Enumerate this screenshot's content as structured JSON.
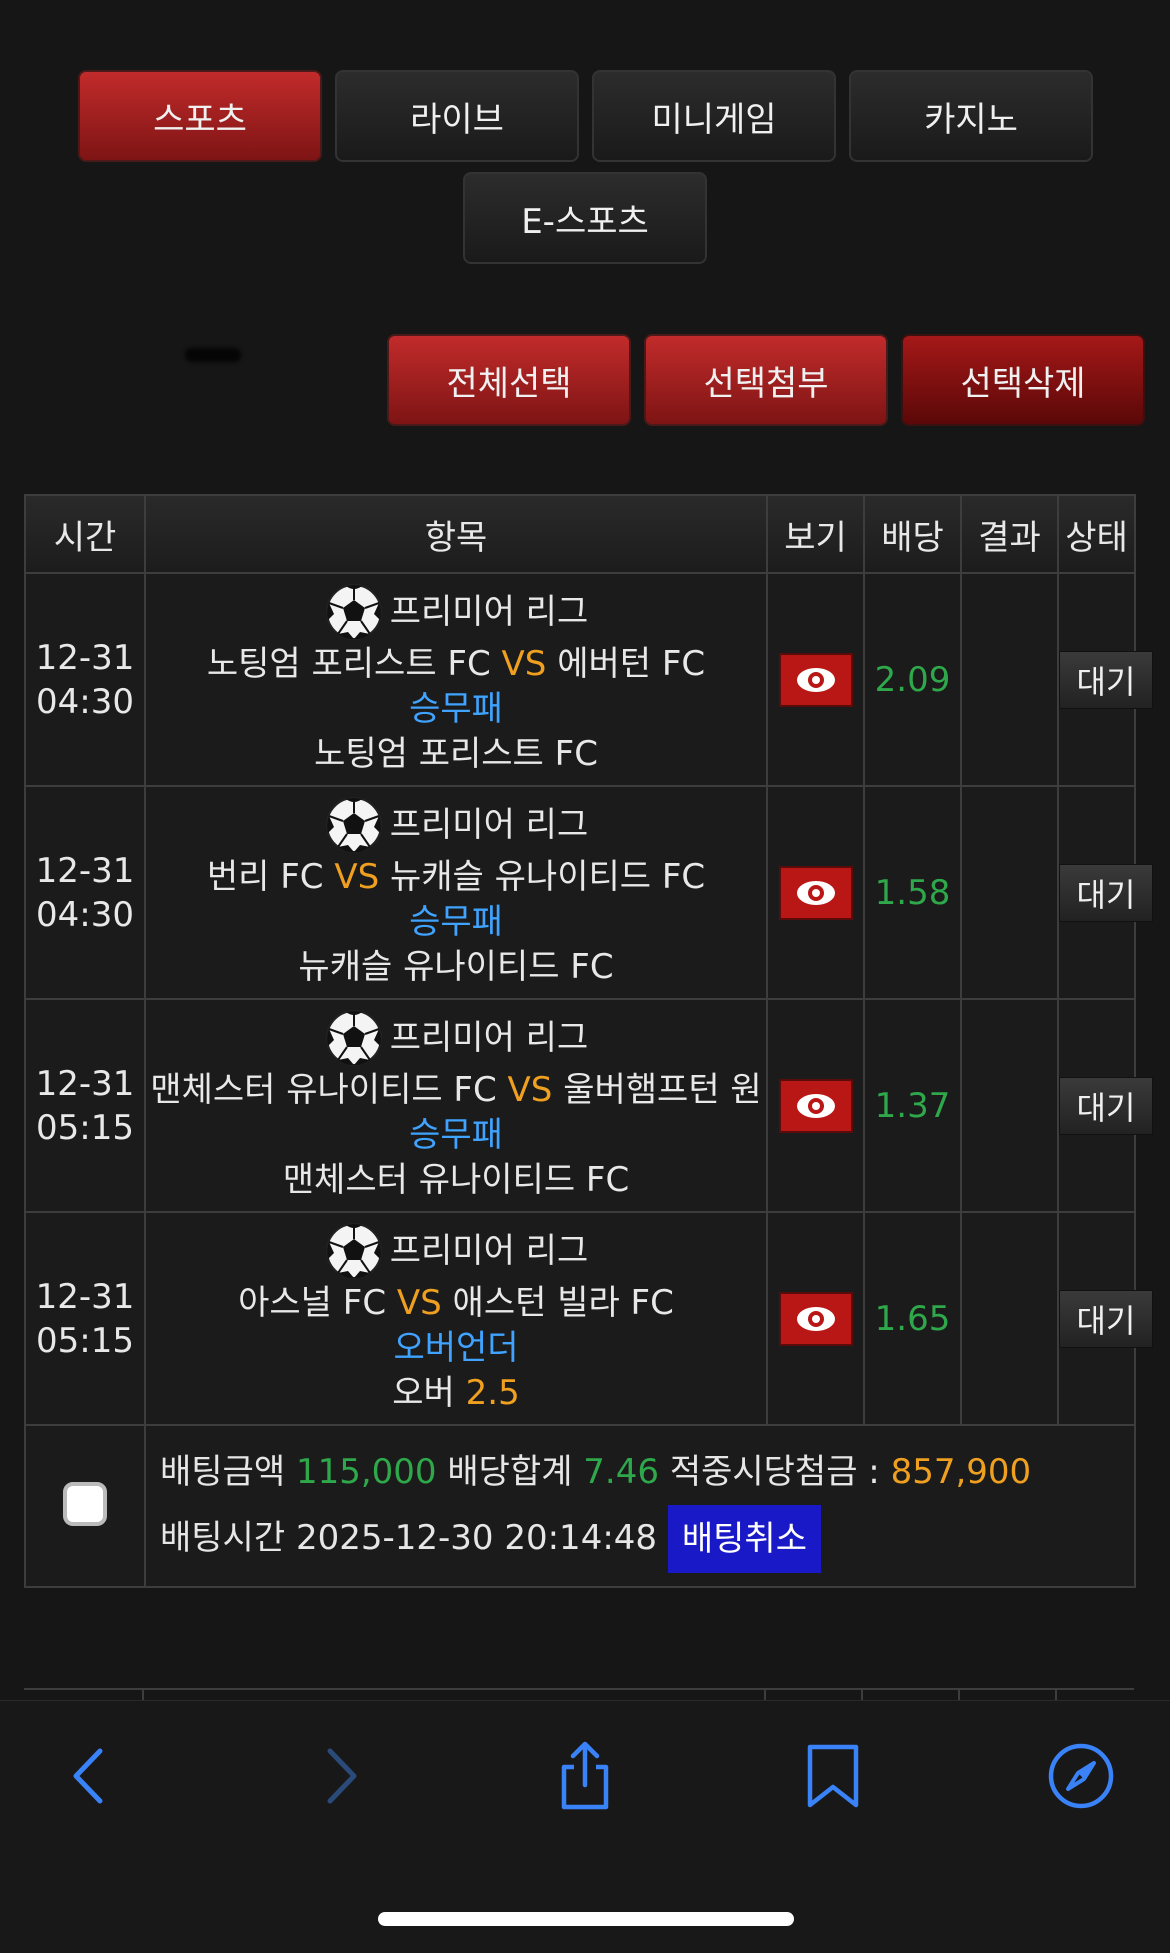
{
  "tabs": {
    "sports": "스포츠",
    "live": "라이브",
    "minigame": "미니게임",
    "casino": "카지노",
    "esports": "E-스포츠"
  },
  "actions": {
    "select_all": "전체선택",
    "attach_selected": "선택첨부",
    "delete_selected": "선택삭제"
  },
  "table": {
    "headers": {
      "time": "시간",
      "item": "항목",
      "view": "보기",
      "odds": "배당",
      "result": "결과",
      "status": "상태"
    },
    "rows": [
      {
        "date": "12-31",
        "time": "04:30",
        "league": "프리미어 리그",
        "home": "노팅엄 포리스트 FC",
        "vs": "VS",
        "away": "에버턴 FC",
        "market": "승무패",
        "pick": "노팅엄 포리스트 FC",
        "pick_value": "",
        "odds": "2.09",
        "result": "",
        "status": "대기"
      },
      {
        "date": "12-31",
        "time": "04:30",
        "league": "프리미어 리그",
        "home": "번리 FC",
        "vs": "VS",
        "away": "뉴캐슬 유나이티드 FC",
        "market": "승무패",
        "pick": "뉴캐슬 유나이티드 FC",
        "pick_value": "",
        "odds": "1.58",
        "result": "",
        "status": "대기"
      },
      {
        "date": "12-31",
        "time": "05:15",
        "league": "프리미어 리그",
        "home": "맨체스터 유나이티드 FC",
        "vs": "VS",
        "away": "울버햄프턴 원",
        "market": "승무패",
        "pick": "맨체스터 유나이티드 FC",
        "pick_value": "",
        "odds": "1.37",
        "result": "",
        "status": "대기"
      },
      {
        "date": "12-31",
        "time": "05:15",
        "league": "프리미어 리그",
        "home": "아스널 FC",
        "vs": "VS",
        "away": "애스턴 빌라 FC",
        "market": "오버언더",
        "pick": "오버",
        "pick_value": "2.5",
        "odds": "1.65",
        "result": "",
        "status": "대기"
      }
    ],
    "summary": {
      "bet_amount_label": "배팅금액",
      "bet_amount": "115,000",
      "total_odds_label": "배당합계",
      "total_odds": "7.46",
      "payout_label": "적중시당첨금 :",
      "payout": "857,900",
      "bet_time_label": "배팅시간",
      "bet_time": "2025-12-30 20:14:48",
      "cancel_label": "배팅취소"
    }
  },
  "colors": {
    "accent_red": "#b91616",
    "vs_orange": "#f0a020",
    "market_blue": "#3fa3ff",
    "odds_green": "#2ea84a",
    "cancel_blue": "#1919c8",
    "toolbar_icon_blue": "#3a82f7"
  },
  "toolbar": {
    "icons": [
      "back-icon",
      "forward-icon",
      "share-icon",
      "bookmarks-icon",
      "compass-icon"
    ]
  }
}
